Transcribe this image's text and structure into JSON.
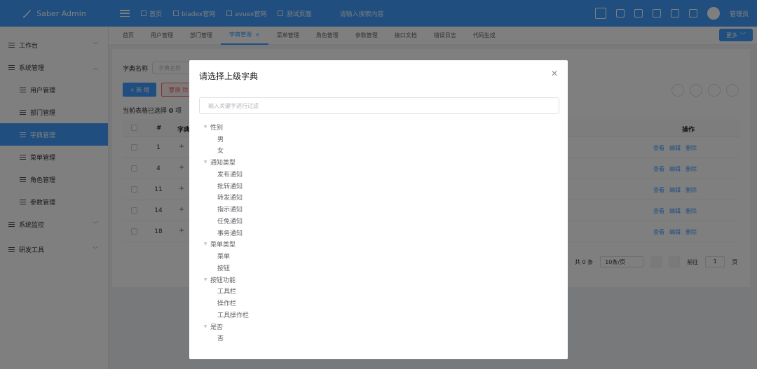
{
  "app": {
    "title": "Saber Admin"
  },
  "topnav": {
    "items": [
      {
        "label": "首页"
      },
      {
        "label": "bladex官网"
      },
      {
        "label": "avuex官网"
      },
      {
        "label": "测试页面"
      }
    ],
    "search_placeholder": "请输入搜索内容",
    "user_name": "管理员"
  },
  "sidebar": {
    "items": [
      {
        "label": "工作台"
      },
      {
        "label": "系统管理"
      },
      {
        "label": "用户管理"
      },
      {
        "label": "部门管理"
      },
      {
        "label": "字典管理"
      },
      {
        "label": "菜单管理"
      },
      {
        "label": "角色管理"
      },
      {
        "label": "参数管理"
      },
      {
        "label": "系统监控"
      },
      {
        "label": "研发工具"
      }
    ]
  },
  "tabs": {
    "items": [
      {
        "label": "首页"
      },
      {
        "label": "用户管理"
      },
      {
        "label": "部门管理"
      },
      {
        "label": "字典管理"
      },
      {
        "label": "菜单管理"
      },
      {
        "label": "角色管理"
      },
      {
        "label": "参数管理"
      },
      {
        "label": "接口文档"
      },
      {
        "label": "错误日志"
      },
      {
        "label": "代码生成"
      }
    ],
    "close_glyph": "×",
    "more_label": "更多"
  },
  "main": {
    "search_label": "字典名称",
    "search_placeholder": "字典名称",
    "add_label": "+ 新 增",
    "delete_label": "删 除",
    "selected_prefix": "当前表格已选择",
    "selected_count": "0",
    "selected_suffix": "项",
    "table": {
      "col_num": "#",
      "col_name": "字典",
      "col_ops": "操作",
      "rows": [
        {
          "num": "1"
        },
        {
          "num": "4"
        },
        {
          "num": "11"
        },
        {
          "num": "14"
        },
        {
          "num": "18"
        }
      ],
      "op_view": "查看",
      "op_edit": "编辑",
      "op_delete": "删除"
    },
    "pager": {
      "total": "共 0 条",
      "page_size": "10条/页",
      "goto_prefix": "前往",
      "page_value": "1",
      "goto_suffix": "页"
    }
  },
  "dialog": {
    "title": "请选择上级字典",
    "filter_placeholder": "输入关键字进行过滤",
    "tree": [
      {
        "label": "性别",
        "children": [
          "男",
          "女"
        ]
      },
      {
        "label": "通知类型",
        "children": [
          "发布通知",
          "批转通知",
          "转发通知",
          "指示通知",
          "任免通知",
          "事务通知"
        ]
      },
      {
        "label": "菜单类型",
        "children": [
          "菜单",
          "按钮"
        ]
      },
      {
        "label": "按钮功能",
        "children": [
          "工具栏",
          "操作栏",
          "工具操作栏"
        ]
      },
      {
        "label": "是否",
        "children": [
          "否"
        ]
      }
    ]
  }
}
